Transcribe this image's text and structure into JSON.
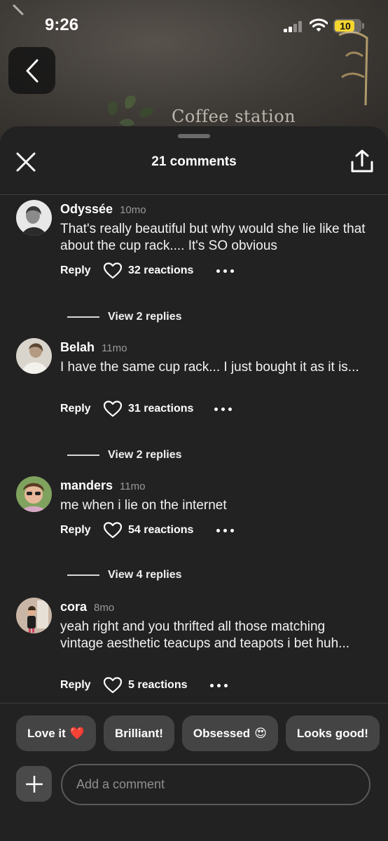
{
  "status_bar": {
    "time": "9:26",
    "battery": "10"
  },
  "background": {
    "caption": "Coffee station"
  },
  "sheet": {
    "title": "21 comments"
  },
  "comments": [
    {
      "name": "Odyssée",
      "time": "10mo",
      "text": "That's really beautiful but why would she lie like that about the cup rack.... It's SO obvious",
      "reply": "Reply",
      "reactions": "32 reactions",
      "view_replies": "View 2 replies"
    },
    {
      "name": "Belah",
      "time": "11mo",
      "text": "I have the same cup rack... I just bought it as it is...",
      "reply": "Reply",
      "reactions": "31 reactions",
      "view_replies": "View 2 replies"
    },
    {
      "name": "manders",
      "time": "11mo",
      "text": "me when i lie on the internet",
      "reply": "Reply",
      "reactions": "54 reactions",
      "view_replies": "View 4 replies"
    },
    {
      "name": "cora",
      "time": "8mo",
      "text": "yeah right and you thrifted all those matching vintage aesthetic teacups and teapots i bet huh...",
      "reply": "Reply",
      "reactions": "5 reactions"
    }
  ],
  "quick_reactions": [
    {
      "label": "Love it",
      "emoji": "❤️"
    },
    {
      "label": "Brilliant!",
      "emoji": ""
    },
    {
      "label": "Obsessed",
      "emoji": "😍"
    },
    {
      "label": "Looks good!",
      "emoji": ""
    }
  ],
  "composer": {
    "placeholder": "Add a comment"
  },
  "icons": [
    "chevron-left-icon",
    "close-icon",
    "share-icon",
    "heart-icon",
    "more-icon",
    "plus-icon",
    "signal-icon",
    "wifi-icon",
    "battery-icon"
  ]
}
